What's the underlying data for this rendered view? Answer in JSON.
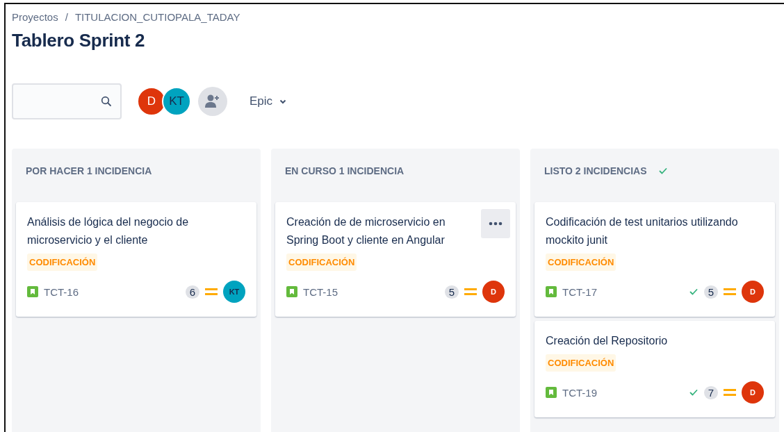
{
  "breadcrumbs": [
    "Proyectos",
    "TITULACION_CUTIOPALA_TADAY"
  ],
  "breadcrumb_separator": "/",
  "title": "Tablero Sprint 2",
  "toolbar": {
    "avatars": [
      {
        "initials": "D",
        "color": "#de350b"
      },
      {
        "initials": "KT",
        "color": "#00a3bf"
      }
    ],
    "filter": "Epic"
  },
  "columns": [
    {
      "title": "POR HACER 1 INCIDENCIA",
      "done": false,
      "cards": [
        {
          "summary": "Análisis de lógica del negocio de microservicio y el cliente",
          "epic": "CODIFICACIÓN",
          "key": "TCT-16",
          "done": false,
          "points": "6",
          "assignee": "KT",
          "color": "#00a3bf",
          "menu_visible": false
        }
      ]
    },
    {
      "title": "EN CURSO 1 INCIDENCIA",
      "done": false,
      "cards": [
        {
          "summary": "Creación de de microservicio en Spring Boot y cliente en Angular",
          "epic": "CODIFICACIÓN",
          "key": "TCT-15",
          "done": false,
          "points": "5",
          "assignee": "D",
          "color": "#de350b",
          "menu_visible": true
        }
      ]
    },
    {
      "title": "LISTO 2 INCIDENCIAS",
      "done": true,
      "cards": [
        {
          "summary": "Codificación de test unitarios utilizando mockito junit",
          "epic": "CODIFICACIÓN",
          "key": "TCT-17",
          "done": true,
          "points": "5",
          "assignee": "D",
          "color": "#de350b",
          "menu_visible": false
        },
        {
          "summary": "Creación del Repositorio",
          "epic": "CODIFICACIÓN",
          "key": "TCT-19",
          "done": true,
          "points": "7",
          "assignee": "D",
          "color": "#de350b",
          "menu_visible": false
        }
      ]
    }
  ]
}
